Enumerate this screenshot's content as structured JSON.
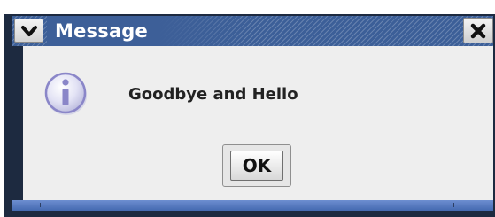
{
  "window": {
    "title": "Message",
    "title_bar_color": "#3c5f98",
    "frame_color": "#1d2a40",
    "body_color": "#eeeeee"
  },
  "controls": {
    "menu_icon": "chevron-down-icon",
    "close_icon": "close-icon"
  },
  "dialog": {
    "icon": "info-icon",
    "message": "Goodbye and Hello",
    "ok_label": "OK"
  }
}
